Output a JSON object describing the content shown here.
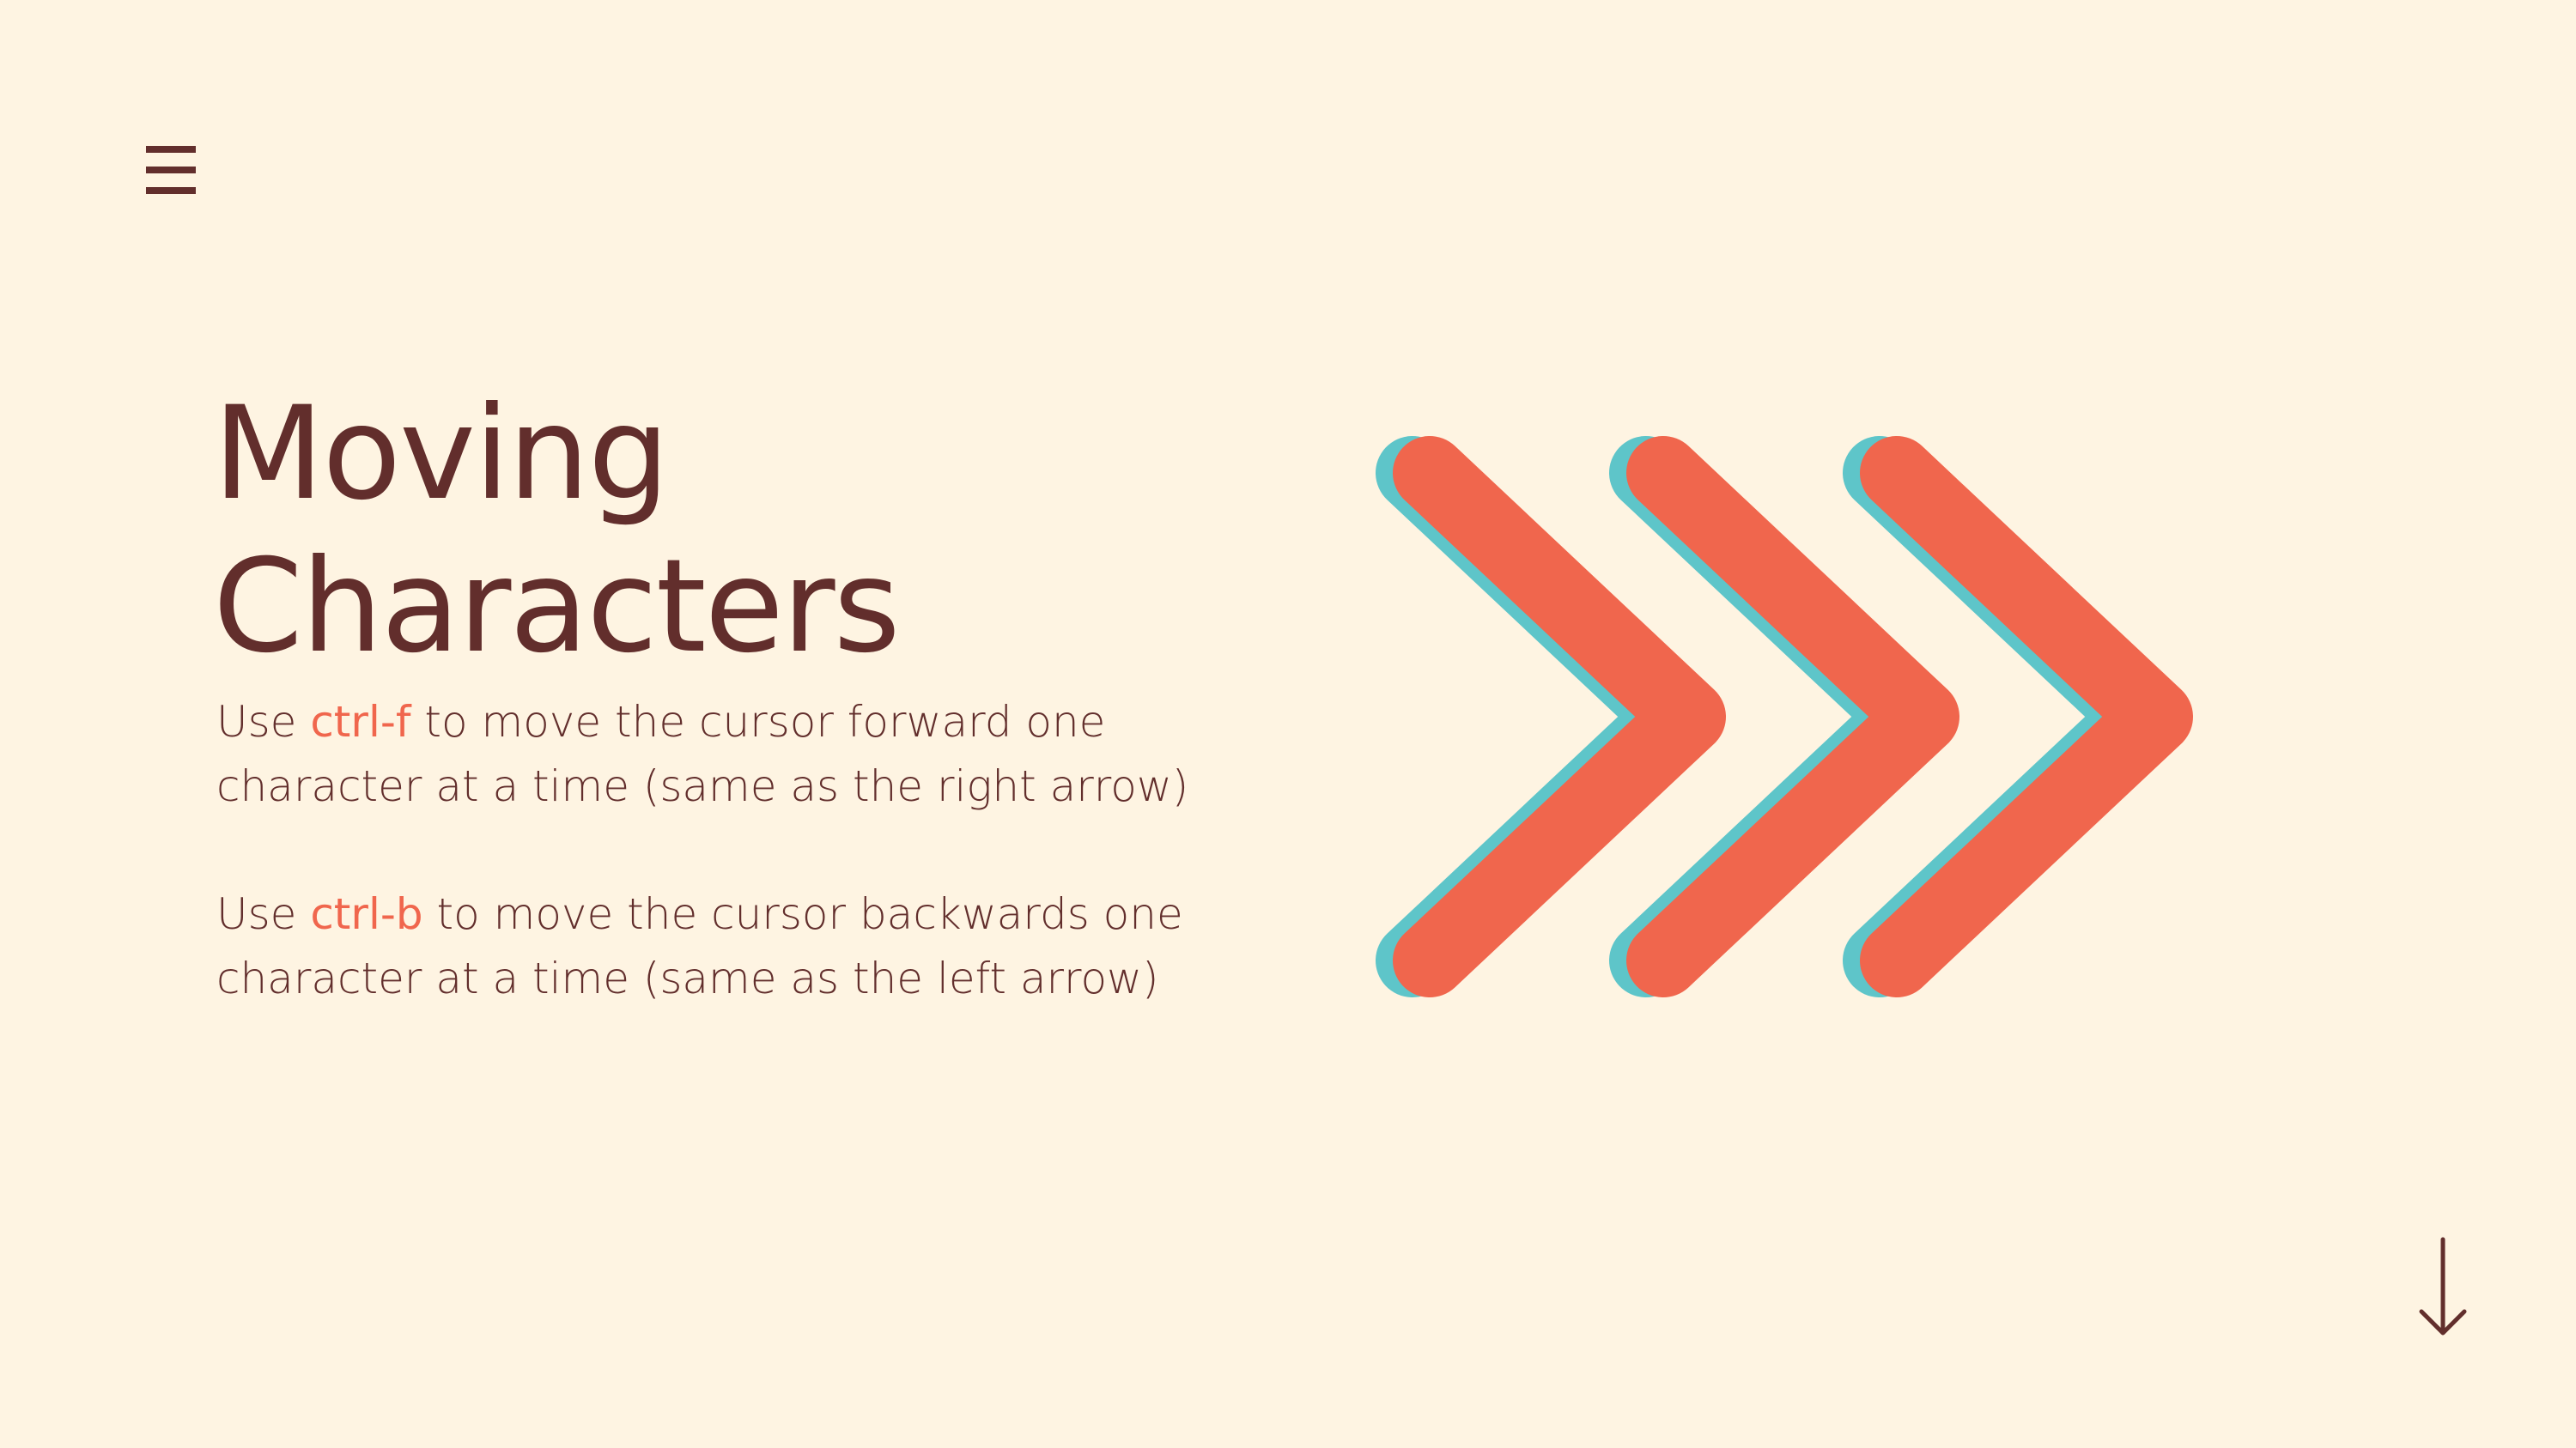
{
  "menu": {
    "icon": "hamburger-menu-icon"
  },
  "title": {
    "line1": "Moving",
    "line2": "Characters"
  },
  "paragraphs": [
    {
      "line1_prefix": "Use ",
      "key": "ctrl-f",
      "line1_suffix": " to move the cursor forward one",
      "line2": "character at a time (same as the right arrow)"
    },
    {
      "line1_prefix": "Use ",
      "key": "ctrl-b",
      "line1_suffix": " to move the cursor backwards one",
      "line2": "character at a time (same as the left arrow)"
    }
  ],
  "graphic": {
    "icon": "triple-chevron-right-icon",
    "count": 3,
    "front_color": "#F0664D",
    "shadow_color": "#5EC5C9"
  },
  "navigation": {
    "icon": "down-arrow-icon"
  },
  "colors": {
    "background": "#FEF4E2",
    "text": "#622E2C",
    "accent": "#F0664D"
  }
}
